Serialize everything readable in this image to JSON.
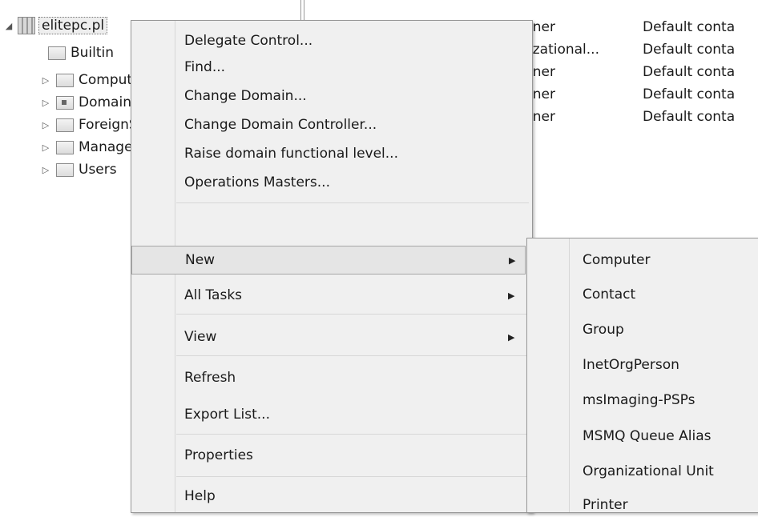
{
  "tree": {
    "root_label": "elitepc.pl",
    "items": [
      {
        "label": "Builtin",
        "expander": ""
      },
      {
        "label": "Computers",
        "expander": "▷"
      },
      {
        "label": "Domain Controllers",
        "expander": "▷"
      },
      {
        "label": "ForeignSecurityPrincipals",
        "expander": "▷"
      },
      {
        "label": "Managed Service Accounts",
        "expander": "▷"
      },
      {
        "label": "Users",
        "expander": "▷"
      }
    ],
    "root_expander": "◢"
  },
  "list": {
    "rows": [
      {
        "type": "iner",
        "desc": "Default conta"
      },
      {
        "type": "izational...",
        "desc": "Default conta"
      },
      {
        "type": "iner",
        "desc": "Default conta"
      },
      {
        "type": "iner",
        "desc": "Default conta"
      },
      {
        "type": "iner",
        "desc": "Default conta"
      }
    ]
  },
  "context_menu": {
    "items": [
      "Delegate Control...",
      "Find...",
      "Change Domain...",
      "Change Domain Controller...",
      "Raise domain functional level...",
      "Operations Masters...",
      "New",
      "All Tasks",
      "View",
      "Refresh",
      "Export List...",
      "Properties",
      "Help"
    ],
    "submenu_arrow": "▶"
  },
  "new_submenu": {
    "items": [
      "Computer",
      "Contact",
      "Group",
      "InetOrgPerson",
      "msImaging-PSPs",
      "MSMQ Queue Alias",
      "Organizational Unit",
      "Printer"
    ]
  }
}
